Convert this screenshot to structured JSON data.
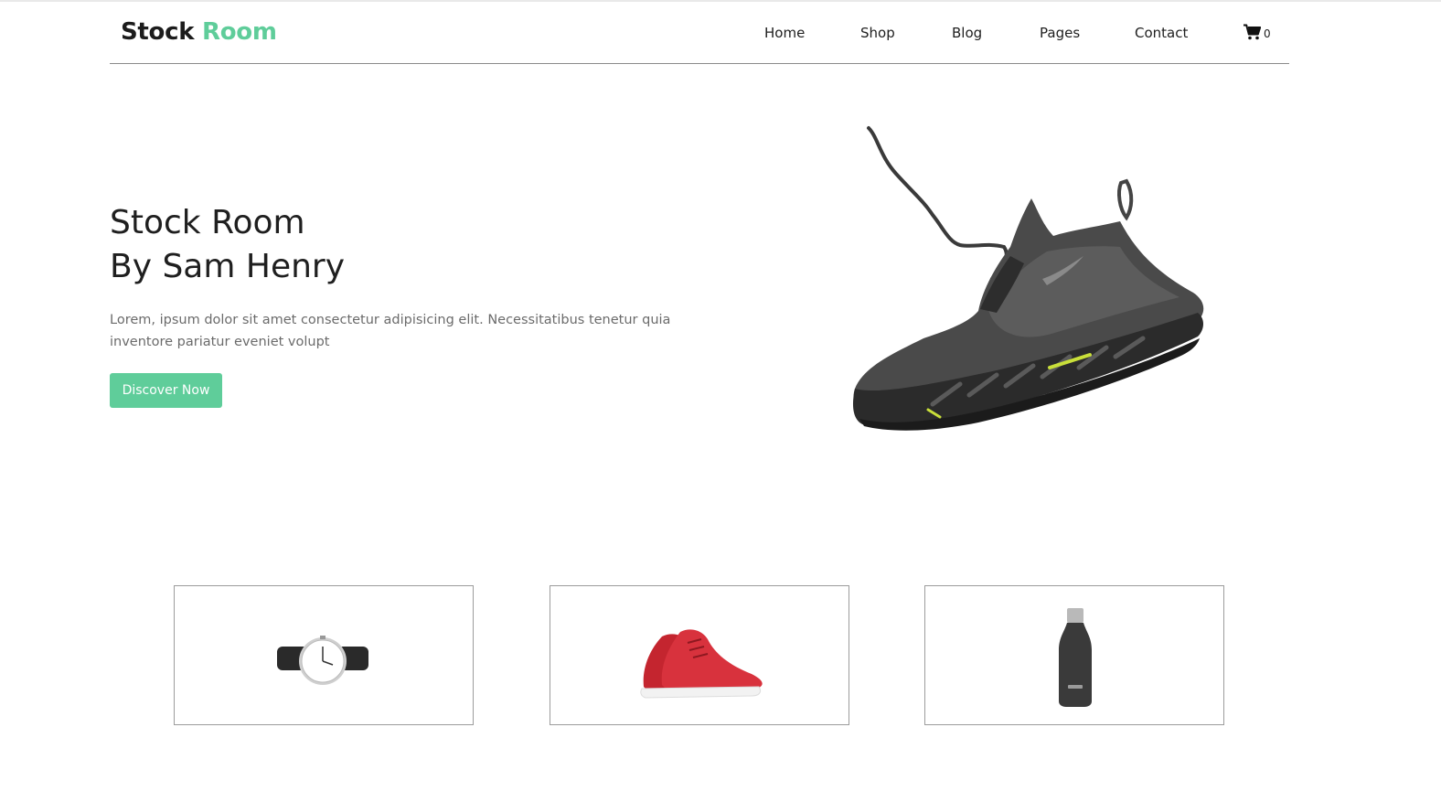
{
  "brand": {
    "name_primary": "Stock",
    "name_accent": "Room",
    "accent_color": "#5fcd9a"
  },
  "nav": {
    "items": [
      {
        "label": "Home"
      },
      {
        "label": "Shop"
      },
      {
        "label": "Blog"
      },
      {
        "label": "Pages"
      },
      {
        "label": "Contact"
      }
    ],
    "cart": {
      "icon": "shopping-cart-icon",
      "count": "0"
    }
  },
  "hero": {
    "title_line1": "Stock Room",
    "title_line2": "By Sam Henry",
    "description": "Lorem, ipsum dolor sit amet consectetur adipisicing elit. Necessitatibus tenetur quia inventore pariatur eveniet volupt",
    "button_label": "Discover Now",
    "image": "sneaker-image"
  },
  "products": [
    {
      "image": "wristwatch-image"
    },
    {
      "image": "red-sneakers-image"
    },
    {
      "image": "water-bottle-image"
    }
  ]
}
